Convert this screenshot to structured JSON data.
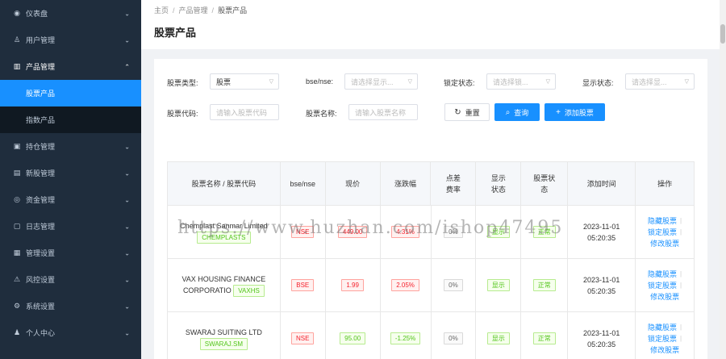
{
  "sidebar": {
    "items": [
      {
        "label": "仪表盘",
        "icon": "dashboard-icon",
        "glyph": "◉",
        "open": false
      },
      {
        "label": "用户管理",
        "icon": "user-manage-icon",
        "glyph": "♙",
        "open": false
      },
      {
        "label": "产品管理",
        "icon": "chart-bar-icon",
        "glyph": "▥",
        "open": true,
        "children": [
          {
            "label": "股票产品",
            "active": true
          },
          {
            "label": "指数产品",
            "active": false
          }
        ]
      },
      {
        "label": "持仓管理",
        "icon": "position-icon",
        "glyph": "▣",
        "open": false
      },
      {
        "label": "新股管理",
        "icon": "ipo-icon",
        "glyph": "▤",
        "open": false
      },
      {
        "label": "资金管理",
        "icon": "money-icon",
        "glyph": "◎",
        "open": false
      },
      {
        "label": "日志管理",
        "icon": "log-icon",
        "glyph": "▢",
        "open": false
      },
      {
        "label": "管理设置",
        "icon": "admin-settings-icon",
        "glyph": "▦",
        "open": false
      },
      {
        "label": "风控设置",
        "icon": "warning-icon",
        "glyph": "⚠",
        "open": false
      },
      {
        "label": "系统设置",
        "icon": "gear-icon",
        "glyph": "⚙",
        "open": false
      },
      {
        "label": "个人中心",
        "icon": "person-icon",
        "glyph": "♟",
        "open": false
      }
    ]
  },
  "breadcrumb": {
    "home": "主页",
    "section": "产品管理",
    "current": "股票产品"
  },
  "page_title": "股票产品",
  "filters": {
    "stock_type": {
      "label": "股票类型:",
      "value": "股票"
    },
    "bse_nse": {
      "label": "bse/nse:",
      "placeholder": "请选择显示..."
    },
    "lock_status": {
      "label": "锁定状态:",
      "placeholder": "请选择锁..."
    },
    "show_status": {
      "label": "显示状态:",
      "placeholder": "请选择显..."
    },
    "stock_code": {
      "label": "股票代码:",
      "placeholder": "请输入股票代码"
    },
    "stock_name": {
      "label": "股票名称:",
      "placeholder": "请输入股票名称"
    }
  },
  "buttons": {
    "reset": "重置",
    "search": "查询",
    "add": "添加股票"
  },
  "table": {
    "headers": [
      "股票名称 / 股票代码",
      "bse/nse",
      "现价",
      "涨跌幅",
      "点差费率",
      "显示状态",
      "股票状态",
      "添加时间",
      "操作"
    ],
    "rows": [
      {
        "name": "Chemplast Sanmar Limited",
        "code": "CHEMPLASTS",
        "exchange": "NSE",
        "price": "449.00",
        "change": "4.31%",
        "change_color": "red",
        "spread": "0%",
        "show": "显示",
        "status": "正常",
        "date": "2023-11-01",
        "time": "05:20:35"
      },
      {
        "name": "VAX HOUSING FINANCE CORPORATIO",
        "code": "VAXHS",
        "exchange": "BSE",
        "price": "1.99",
        "change": "2.05%",
        "change_color": "red",
        "spread": "0%",
        "show": "显示",
        "status": "正常",
        "date": "2023-11-01",
        "time": "05:20:35"
      },
      {
        "name": "SWARAJ SUITING LTD",
        "code": "SWARAJ.SM",
        "exchange": "NSE",
        "price": "95.00",
        "change": "-1.25%",
        "change_color": "green",
        "spread": "0%",
        "show": "显示",
        "status": "正常",
        "date": "2023-11-01",
        "time": "05:20:35"
      }
    ],
    "ops": {
      "hide": "隐藏股票",
      "lock": "锁定股票",
      "edit": "修改股票"
    }
  },
  "watermark": "https://www.huzhan.com/ishop47495"
}
